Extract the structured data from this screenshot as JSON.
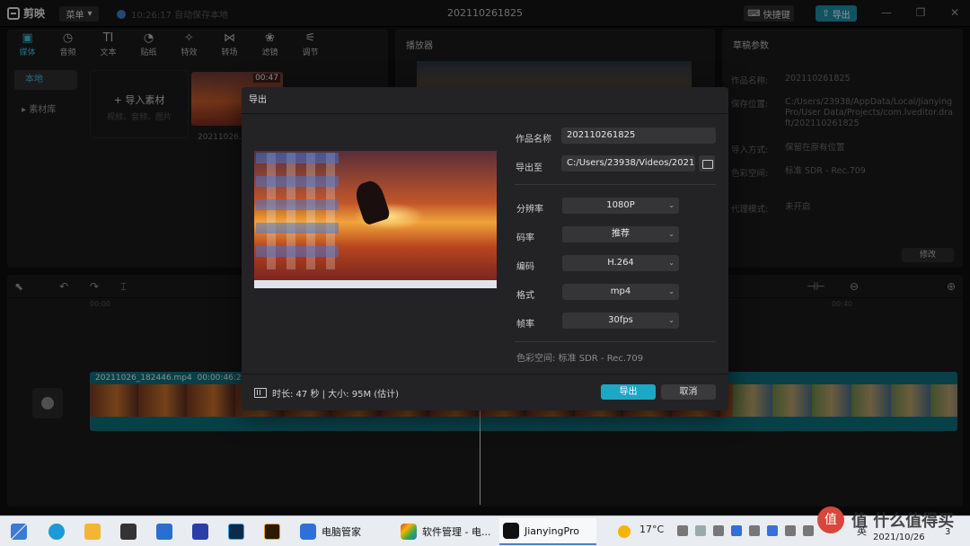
{
  "app": {
    "logo_text": "剪映",
    "menu_label": "菜单",
    "autosave_text": "10:26:17 自动保存本地",
    "project_title": "202110261825",
    "shortcut_label": "快捷键",
    "export_label": "导出"
  },
  "toolbar_tabs": [
    {
      "label": "媒体",
      "icon": "media-icon",
      "glyph": "▣"
    },
    {
      "label": "音频",
      "icon": "audio-icon",
      "glyph": "◷"
    },
    {
      "label": "文本",
      "icon": "text-icon",
      "glyph": "TI"
    },
    {
      "label": "贴纸",
      "icon": "sticker-icon",
      "glyph": "◔"
    },
    {
      "label": "特效",
      "icon": "effects-icon",
      "glyph": "✧"
    },
    {
      "label": "转场",
      "icon": "transition-icon",
      "glyph": "⋈"
    },
    {
      "label": "滤镜",
      "icon": "filter-icon",
      "glyph": "❀"
    },
    {
      "label": "调节",
      "icon": "adjust-icon",
      "glyph": "⚟"
    }
  ],
  "media_sidebar": [
    {
      "label": "本地"
    },
    {
      "label": "▸ 素材库"
    }
  ],
  "import": {
    "title": "+ 导入素材",
    "hint": "视频、音频、图片"
  },
  "media_item": {
    "duration": "00:47",
    "caption": "20211026..."
  },
  "player": {
    "title": "播放器"
  },
  "draft": {
    "title": "草稿参数",
    "rows": [
      {
        "key": "作品名称:",
        "value": "202110261825"
      },
      {
        "key": "保存位置:",
        "value": "C:/Users/23938/AppData/Local/JianyingPro/User Data/Projects/com.lveditor.draft/202110261825"
      },
      {
        "key": "导入方式:",
        "value": "保留在原有位置"
      },
      {
        "key": "色彩空间:",
        "value": "标准 SDR - Rec.709"
      },
      {
        "key": "代理模式:",
        "value": "未开启"
      }
    ],
    "modify_label": "修改"
  },
  "timeline": {
    "ruler_start": "00:00",
    "ruler_end": "00:40",
    "clip_name": "20211026_182446.mp4",
    "clip_duration": "00:00:46:24"
  },
  "export_dialog": {
    "title": "导出",
    "name_label": "作品名称",
    "name_value": "202110261825",
    "path_label": "导出至",
    "path_value": "C:/Users/23938/Videos/2021...",
    "settings": [
      {
        "label": "分辨率",
        "value": "1080P"
      },
      {
        "label": "码率",
        "value": "推荐"
      },
      {
        "label": "编码",
        "value": "H.264"
      },
      {
        "label": "格式",
        "value": "mp4"
      },
      {
        "label": "帧率",
        "value": "30fps"
      }
    ],
    "color_space": "色彩空间: 标准 SDR - Rec.709",
    "footer_info": "时长: 47 秒 | 大小: 95M (估计)",
    "export_button": "导出",
    "cancel_button": "取消"
  },
  "taskbar": {
    "apps": [
      {
        "label": "电脑管家",
        "color": "#2f6fd8"
      },
      {
        "label": "软件管理 - 电...",
        "color": "#e0442e"
      },
      {
        "label": "JianyingPro",
        "color": "#111111"
      }
    ],
    "temperature": "17°C",
    "ime": "英",
    "date": "2021/10/26",
    "notification_count": "3",
    "watermark": "值 什么值得买"
  }
}
